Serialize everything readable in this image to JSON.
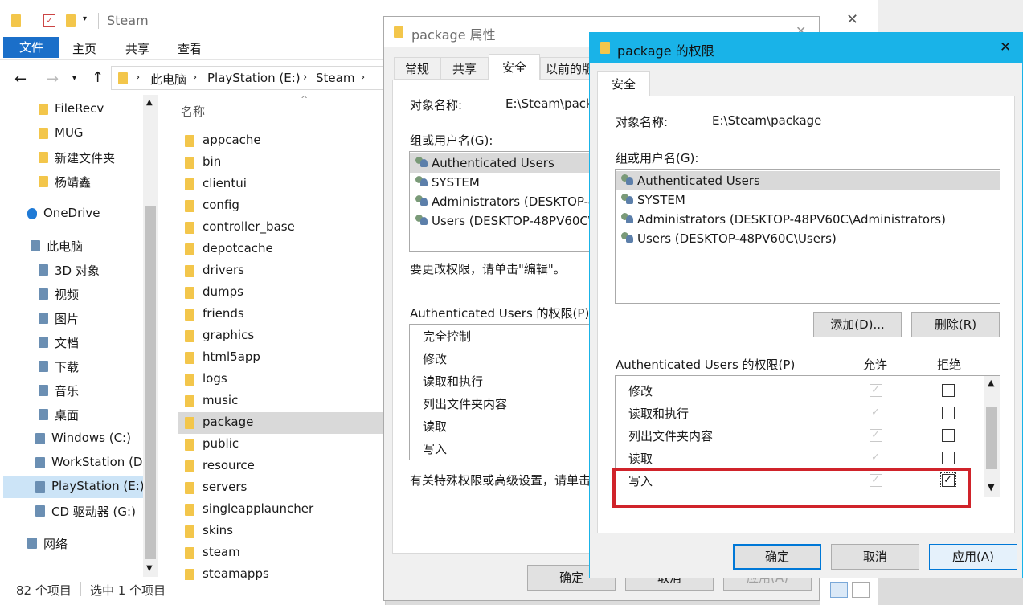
{
  "explorer": {
    "title": "Steam",
    "ribbon_tabs": [
      "文件",
      "主页",
      "共享",
      "查看"
    ],
    "path": [
      "此电脑",
      "PlayStation (E:)",
      "Steam"
    ],
    "column_name": "名称",
    "nav": [
      {
        "label": "FileRecv",
        "icon": "folder-icon"
      },
      {
        "label": "MUG",
        "icon": "folder-icon"
      },
      {
        "label": "新建文件夹",
        "icon": "folder-icon"
      },
      {
        "label": "杨靖鑫",
        "icon": "folder-icon"
      },
      {
        "label": "OneDrive",
        "icon": "cloud-icon"
      },
      {
        "label": "此电脑",
        "icon": "computer-icon"
      },
      {
        "label": "3D 对象",
        "icon": "cube-icon"
      },
      {
        "label": "视频",
        "icon": "video-icon"
      },
      {
        "label": "图片",
        "icon": "picture-icon"
      },
      {
        "label": "文档",
        "icon": "document-icon"
      },
      {
        "label": "下载",
        "icon": "download-icon"
      },
      {
        "label": "音乐",
        "icon": "music-icon"
      },
      {
        "label": "桌面",
        "icon": "desktop-icon"
      },
      {
        "label": "Windows (C:)",
        "icon": "drive-icon"
      },
      {
        "label": "WorkStation (D",
        "icon": "drive-icon"
      },
      {
        "label": "PlayStation (E:)",
        "icon": "drive-icon"
      },
      {
        "label": "CD 驱动器 (G:)",
        "icon": "cd-icon"
      },
      {
        "label": "网络",
        "icon": "network-icon"
      }
    ],
    "files": [
      "appcache",
      "bin",
      "clientui",
      "config",
      "controller_base",
      "depotcache",
      "drivers",
      "dumps",
      "friends",
      "graphics",
      "html5app",
      "logs",
      "music",
      "package",
      "public",
      "resource",
      "servers",
      "singleapplauncher",
      "skins",
      "steam",
      "steamapps"
    ],
    "status_count": "82 个项目",
    "status_selected": "选中 1 个项目"
  },
  "props": {
    "title": "package 属性",
    "tabs": [
      "常规",
      "共享",
      "安全",
      "以前的版"
    ],
    "object_label": "对象名称:",
    "object_value": "E:\\Steam\\pack",
    "group_label": "组或用户名(G):",
    "users": [
      "Authenticated Users",
      "SYSTEM",
      "Administrators (DESKTOP-4",
      "Users (DESKTOP-48PV60C\\"
    ],
    "edit_hint": "要更改权限，请单击\"编辑\"。",
    "perm_label": "Authenticated Users 的权限(P)",
    "perms": [
      "完全控制",
      "修改",
      "读取和执行",
      "列出文件夹内容",
      "读取",
      "写入"
    ],
    "special_hint": "有关特殊权限或高级设置，请单击",
    "ok": "确定",
    "cancel": "取消",
    "apply": "应用(A)"
  },
  "perm_dialog": {
    "title": "package 的权限",
    "tab": "安全",
    "object_label": "对象名称:",
    "object_value": "E:\\Steam\\package",
    "group_label": "组或用户名(G):",
    "users": [
      "Authenticated Users",
      "SYSTEM",
      "Administrators (DESKTOP-48PV60C\\Administrators)",
      "Users (DESKTOP-48PV60C\\Users)"
    ],
    "add": "添加(D)...",
    "remove": "删除(R)",
    "perm_label": "Authenticated Users 的权限(P)",
    "allow": "允许",
    "deny": "拒绝",
    "perms": [
      {
        "name": "修改",
        "allow": true,
        "deny": false
      },
      {
        "name": "读取和执行",
        "allow": true,
        "deny": false
      },
      {
        "name": "列出文件夹内容",
        "allow": true,
        "deny": false
      },
      {
        "name": "读取",
        "allow": true,
        "deny": false
      },
      {
        "name": "写入",
        "allow": true,
        "deny": true
      }
    ],
    "ok": "确定",
    "cancel": "取消",
    "apply": "应用(A)",
    "accent": "#19b3e8",
    "highlight": "#d0232a"
  }
}
